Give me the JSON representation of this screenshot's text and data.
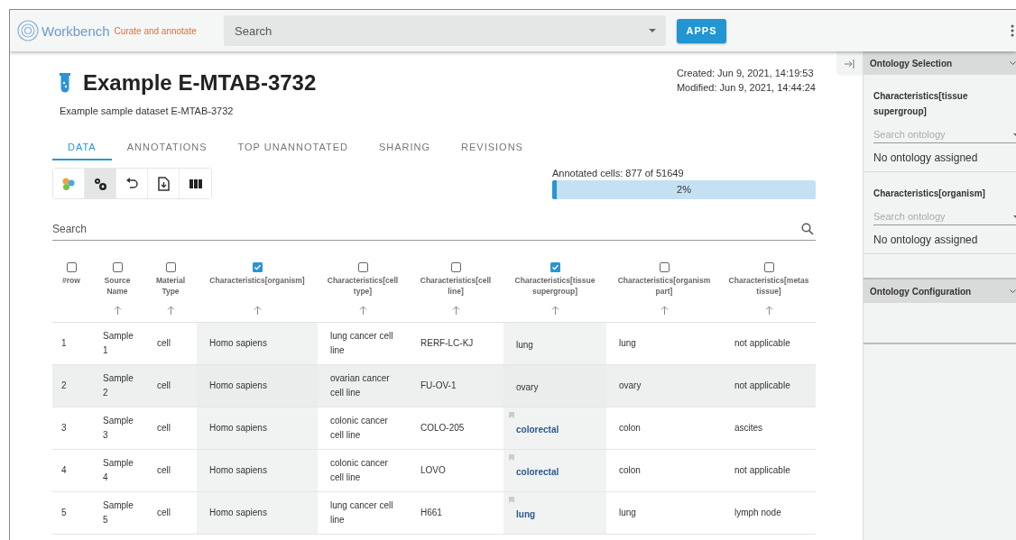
{
  "header": {
    "brand": "Workbench",
    "tagline": "Curate and annotate",
    "search": {
      "placeholder": "Search"
    },
    "apps_button": "APPS"
  },
  "dataset": {
    "title": "Example E-MTAB-3732",
    "subtitle": "Example sample dataset E-MTAB-3732",
    "created": "Created: Jun 9, 2021, 14:19:53",
    "modified": "Modified: Jun 9, 2021, 14:44:24"
  },
  "tabs": [
    {
      "label": "DATA",
      "selected": true
    },
    {
      "label": "ANNOTATIONS",
      "selected": false
    },
    {
      "label": "TOP UNANNOTATED",
      "selected": false
    },
    {
      "label": "SHARING",
      "selected": false
    },
    {
      "label": "REVISIONS",
      "selected": false
    }
  ],
  "toolbar": [
    {
      "kind": "colors",
      "selected": false
    },
    {
      "kind": "settings",
      "selected": true
    },
    {
      "kind": "undo",
      "selected": false
    },
    {
      "kind": "export",
      "selected": false
    },
    {
      "kind": "columns",
      "selected": false
    }
  ],
  "progress": {
    "label": "Annotated cells: 877 of 51649",
    "level": 0.017,
    "reading": "2%"
  },
  "table_search": {
    "placeholder": "Search"
  },
  "table": {
    "columns": [
      {
        "label": "#row",
        "checked": false
      },
      {
        "label": "Source Name",
        "checked": false
      },
      {
        "label": "Material Type",
        "checked": false
      },
      {
        "label": "Characteristics[organism]",
        "checked": true
      },
      {
        "label": "Characteristics[cell type]",
        "checked": false
      },
      {
        "label": "Characteristics[cell line]",
        "checked": false
      },
      {
        "label": "Characteristics[tissue supergroup]",
        "checked": true
      },
      {
        "label": "Characteristics[organism part]",
        "checked": false
      },
      {
        "label": "Characteristics[metas tissue]",
        "checked": false
      }
    ],
    "rows": [
      {
        "highlighted": false,
        "cells": [
          "1",
          "Sample 1",
          "cell",
          "Homo sapiens",
          "lung cancer cell line",
          "RERF-LC-KJ",
          {
            "text": "lung",
            "annotated": false
          },
          "lung",
          "not applicable"
        ]
      },
      {
        "highlighted": true,
        "cells": [
          "2",
          "Sample 2",
          "cell",
          "Homo sapiens",
          "ovarian cancer cell line",
          "FU-OV-1",
          {
            "text": "ovary",
            "annotated": false
          },
          "ovary",
          "not applicable"
        ]
      },
      {
        "highlighted": false,
        "cells": [
          "3",
          "Sample 3",
          "cell",
          "Homo sapiens",
          "colonic cancer cell line",
          "COLO-205",
          {
            "text": "colorectal",
            "annotated": true
          },
          "colon",
          "ascites"
        ]
      },
      {
        "highlighted": false,
        "cells": [
          "4",
          "Sample 4",
          "cell",
          "Homo sapiens",
          "colonic cancer cell line",
          "LOVO",
          {
            "text": "colorectal",
            "annotated": true
          },
          "colon",
          "not applicable"
        ]
      },
      {
        "highlighted": false,
        "cells": [
          "5",
          "Sample 5",
          "cell",
          "Homo sapiens",
          "lung cancer cell line",
          "H661",
          {
            "text": "lung",
            "annotated": true
          },
          "lung",
          "lymph node"
        ]
      }
    ]
  },
  "side_panel": {
    "selection_title": "Ontology Selection",
    "fields": [
      {
        "label": "Characteristics[tissue supergroup]",
        "placeholder": "Search ontology",
        "status": "No ontology assigned"
      },
      {
        "label": "Characteristics[organism]",
        "placeholder": "Search ontology",
        "status": "No ontology assigned"
      }
    ],
    "configuration_title": "Ontology Configuration"
  }
}
